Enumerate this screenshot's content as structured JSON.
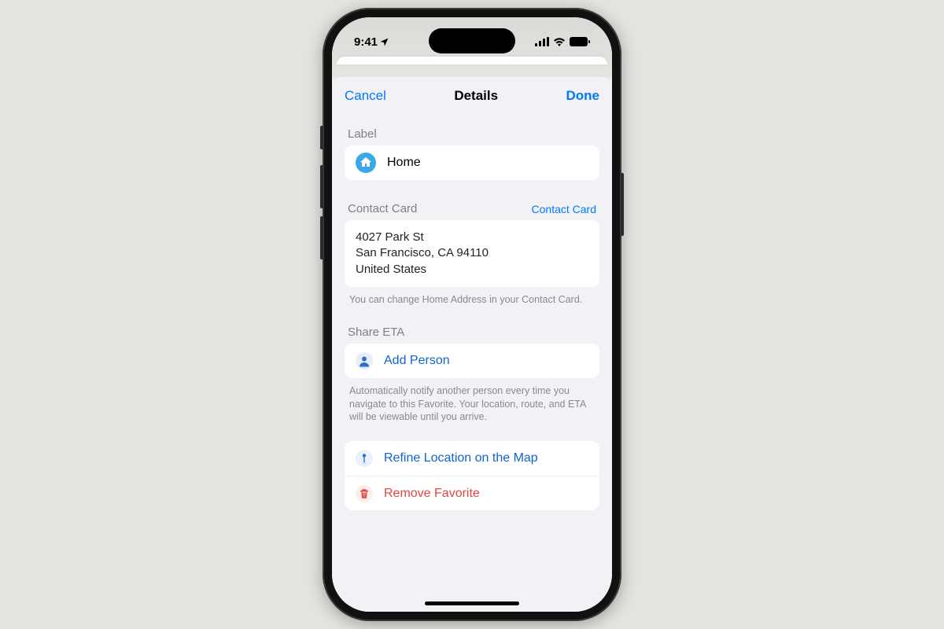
{
  "status": {
    "time": "9:41"
  },
  "nav": {
    "cancel": "Cancel",
    "title": "Details",
    "done": "Done"
  },
  "label_section": {
    "header": "Label",
    "name": "Home"
  },
  "contact_section": {
    "header": "Contact Card",
    "link": "Contact Card",
    "address_line1": "4027 Park St",
    "address_line2": "San Francisco, CA 94110",
    "address_line3": "United States",
    "footnote": "You can change Home Address in your Contact Card."
  },
  "share_eta_section": {
    "header": "Share ETA",
    "add_person": "Add Person",
    "footnote": "Automatically notify another person every time you navigate to this Favorite. Your location, route, and ETA will be viewable until you arrive."
  },
  "actions": {
    "refine": "Refine Location on the Map",
    "remove": "Remove Favorite"
  }
}
